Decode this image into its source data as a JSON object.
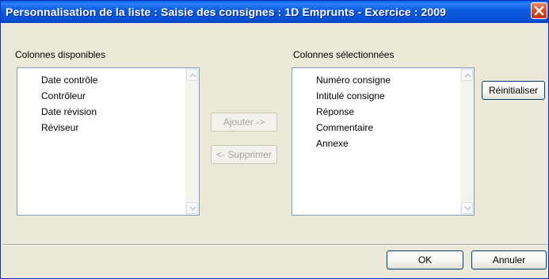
{
  "window": {
    "title": "Personnalisation de la liste : Saisie des consignes : 1D Emprunts - Exercice : 2009"
  },
  "available": {
    "label": "Colonnes disponibles",
    "items": [
      "Date contrôle",
      "Contrôleur",
      "Date révision",
      "Réviseur"
    ]
  },
  "selected": {
    "label": "Colonnes sélectionnées",
    "items": [
      "Numéro consigne",
      "Intitulé consigne",
      "Réponse",
      "Commentaire",
      "Annexe"
    ]
  },
  "buttons": {
    "add": "Ajouter ->",
    "remove": "<- Supprimer",
    "reset": "Réinitialiser",
    "ok": "OK",
    "cancel": "Annuler"
  },
  "colors": {
    "titlebar": "#0a5ae0",
    "dialog_bg": "#ece9d8",
    "close_button": "#d9451b",
    "list_border": "#7f9db9"
  },
  "icons": {
    "close": "close-icon",
    "scroll_up": "scroll-up-arrow-icon",
    "scroll_down": "scroll-down-arrow-icon"
  }
}
